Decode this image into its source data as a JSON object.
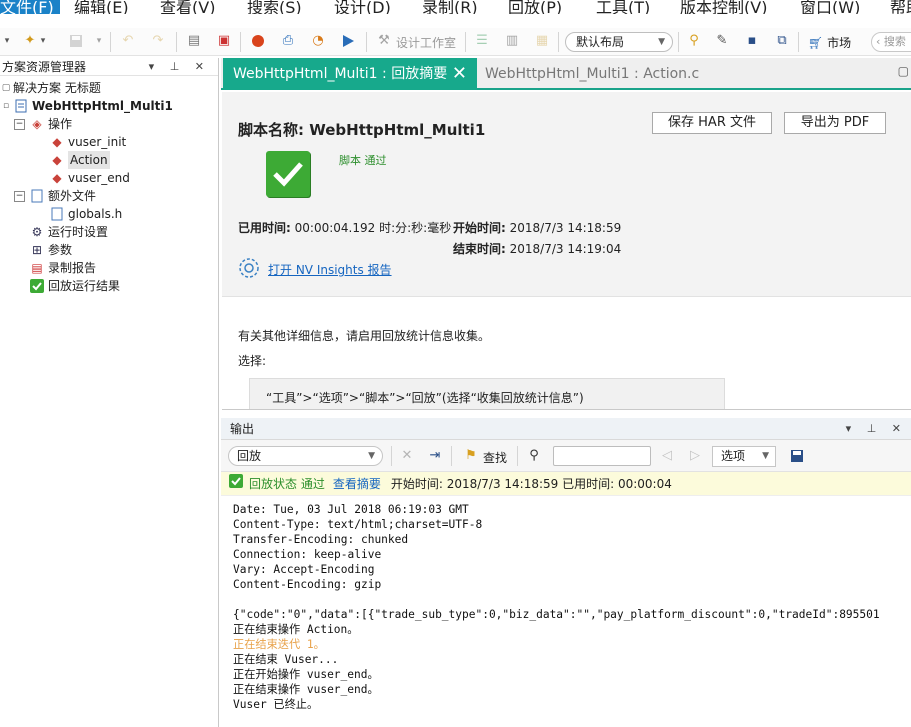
{
  "menu": {
    "items": [
      "文件(F)",
      "编辑(E)",
      "查看(V)",
      "搜索(S)",
      "设计(D)",
      "录制(R)",
      "回放(P)",
      "工具(T)",
      "版本控制(V)",
      "窗口(W)",
      "帮助"
    ]
  },
  "toolbar": {
    "design_studio_label": "设计工作室",
    "layout_value": "默认布局",
    "market_label": "市场",
    "search_placeholder": "搜索"
  },
  "explorer": {
    "title": "方案资源管理器",
    "items": [
      {
        "label": "解决方案 无标题"
      },
      {
        "label": "WebHttpHtml_Multi1"
      },
      {
        "label": "操作"
      },
      {
        "label": "vuser_init"
      },
      {
        "label": "Action"
      },
      {
        "label": "vuser_end"
      },
      {
        "label": "额外文件"
      },
      {
        "label": "globals.h"
      },
      {
        "label": "运行时设置"
      },
      {
        "label": "参数"
      },
      {
        "label": "录制报告"
      },
      {
        "label": "回放运行结果"
      }
    ]
  },
  "tabs": {
    "active": "WebHttpHtml_Multi1 : 回放摘要",
    "inactive": "WebHttpHtml_Multi1 : Action.c",
    "close": "✕"
  },
  "summary": {
    "script_name": "脚本名称: WebHttpHtml_Multi1",
    "save_har": "保存 HAR 文件",
    "export_pdf": "导出为 PDF",
    "status": "脚本 通过",
    "elapsed_label": "已用时间:",
    "elapsed_value": "00:00:04.192 时:分:秒:毫秒",
    "start_label": "开始时间:",
    "start_value": "2018/7/3 14:18:59",
    "end_label": "结束时间:",
    "end_value": "2018/7/3 14:19:04",
    "nv_link": "打开 NV Insights 报告",
    "info_text": "有关其他详细信息，请启用回放统计信息收集。",
    "choose_text": "选择:",
    "hint_text": "“工具”>“选项”>“脚本”>“回放”(选择“收集回放统计信息”)"
  },
  "output": {
    "title": "输出",
    "source_value": "回放",
    "find_label": "查找",
    "options_label": "选项",
    "status_pass": "回放状态 通过",
    "view_summary": "查看摘要",
    "time_info": "开始时间: 2018/7/3 14:18:59 已用时间: 00:00:04",
    "log_lines": [
      "Date: Tue, 03 Jul 2018 06:19:03 GMT",
      "Content-Type: text/html;charset=UTF-8",
      "Transfer-Encoding: chunked",
      "Connection: keep-alive",
      "Vary: Accept-Encoding",
      "Content-Encoding: gzip",
      "",
      "{\"code\":\"0\",\"data\":[{\"trade_sub_type\":0,\"biz_data\":\"\",\"pay_platform_discount\":0,\"tradeId\":895501",
      "正在结束操作 Action。",
      "正在结束迭代 1。",
      "正在结束 Vuser...",
      "正在开始操作 vuser_end。",
      "正在结束操作 vuser_end。",
      "Vuser 已终止。"
    ]
  },
  "colors": {
    "accent_tab": "#17a98c",
    "pass_green": "#3daa35",
    "link_blue": "#1565c0",
    "status_bg": "#fcfbdb",
    "log_orange": "#e8a24a"
  }
}
